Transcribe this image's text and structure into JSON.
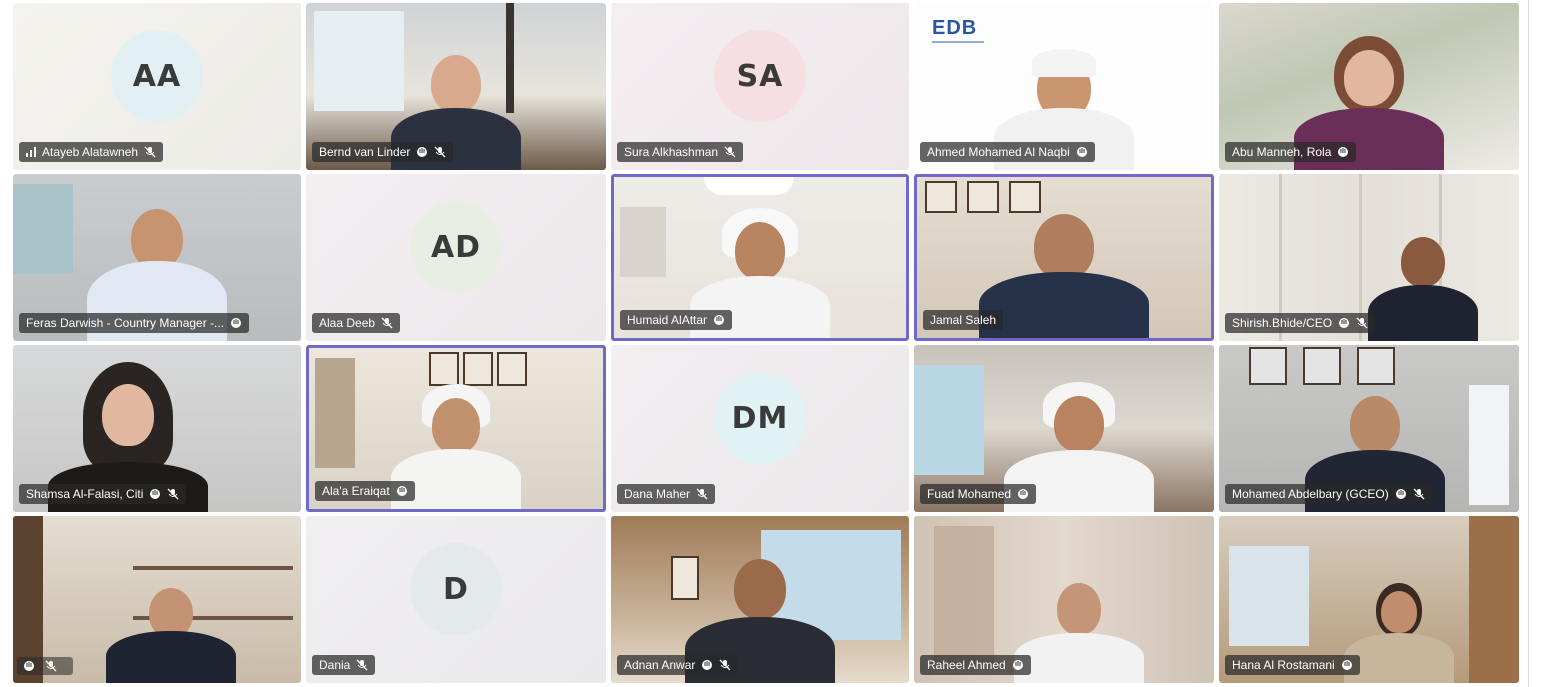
{
  "window": {
    "title": ""
  },
  "participants": [
    {
      "name": "Atayeb Alatawneh",
      "initials": "AA",
      "avatar_color": "#e3f0f3",
      "signal": true,
      "muted": true
    },
    {
      "name": "Bernd van Linder",
      "video": true,
      "raise_hand": true,
      "muted": true
    },
    {
      "name": "Sura Alkhashman",
      "initials": "SA",
      "avatar_color": "#f6dfe3",
      "muted": true
    },
    {
      "name": "Ahmed Mohamed Al Naqbi",
      "video": true,
      "raise_hand": true,
      "logo": "EDB"
    },
    {
      "name": "Abu Manneh, Rola",
      "video": true,
      "raise_hand": true
    },
    {
      "name": "Feras Darwish - Country Manager -...",
      "video": true,
      "raise_hand": true
    },
    {
      "name": "Alaa Deeb",
      "initials": "AD",
      "avatar_color": "#e8efe2",
      "muted": true
    },
    {
      "name": "Humaid AlAttar",
      "video": true,
      "raise_hand": true,
      "active": true
    },
    {
      "name": "Jamal Saleh",
      "video": true,
      "active": true
    },
    {
      "name": "Shirish.Bhide/CEO",
      "video": true,
      "raise_hand": true,
      "muted": true
    },
    {
      "name": "Shamsa Al-Falasi, Citi",
      "video": true,
      "raise_hand": true,
      "muted": true
    },
    {
      "name": "Ala'a Eraiqat",
      "video": true,
      "raise_hand": true,
      "active": true
    },
    {
      "name": "Dana Maher",
      "initials": "DM",
      "avatar_color": "#e0f2f4",
      "muted": true
    },
    {
      "name": "Fuad Mohamed",
      "video": true,
      "raise_hand": true
    },
    {
      "name": "Mohamed Abdelbary (GCEO)",
      "video": true,
      "raise_hand": true,
      "muted": true
    },
    {
      "name": "",
      "video": true,
      "raise_hand": true,
      "muted": true
    },
    {
      "name": "Dania",
      "initials": "D",
      "avatar_color": "#e4e9ec",
      "muted": true
    },
    {
      "name": "Adnan Anwar",
      "video": true,
      "raise_hand": true,
      "muted": true
    },
    {
      "name": "Raheel Ahmed",
      "video": true,
      "raise_hand": true
    },
    {
      "name": "Hana Al Rostamani",
      "video": true,
      "raise_hand": true
    }
  ],
  "icons": {
    "muted": "mic-off-icon",
    "raise_hand": "raise-hand-icon",
    "signal": "signal-bars-icon"
  },
  "colors": {
    "active_border": "#6f6ac8",
    "nametag_bg": "#282828"
  }
}
